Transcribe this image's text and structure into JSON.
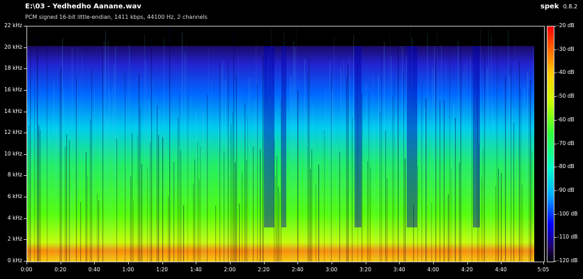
{
  "header": {
    "file_title": "E:\\03 - Yedhedho Aanane.wav",
    "format_info": "PCM signed 16-bit little-endian, 1411 kbps, 44100 Hz, 2 channels",
    "app_name": "spek",
    "app_version": "0.8.2"
  },
  "chart_data": {
    "type": "heatmap",
    "title": "E:\\03 - Yedhedho Aanane.wav",
    "subtitle": "PCM signed 16-bit little-endian, 1411 kbps, 44100 Hz, 2 channels",
    "y_ticks": [
      "22 kHz",
      "20 kHz",
      "18 kHz",
      "16 kHz",
      "14 kHz",
      "12 kHz",
      "10 kHz",
      "8 kHz",
      "6 kHz",
      "4 kHz",
      "2 kHz",
      "0 kHz"
    ],
    "x_ticks": [
      "0:00",
      "0:20",
      "0:40",
      "1:00",
      "1:20",
      "1:40",
      "2:00",
      "2:20",
      "2:40",
      "3:00",
      "3:20",
      "3:40",
      "4:00",
      "4:20",
      "4:40",
      "5:05"
    ],
    "db_ticks": [
      "-20 dB",
      "-30 dB",
      "-40 dB",
      "-50 dB",
      "-60 dB",
      "-70 dB",
      "-80 dB",
      "-90 dB",
      "-100 dB",
      "-110 dB",
      "-120 dB"
    ],
    "ylim_khz": [
      0,
      22
    ],
    "xlim_seconds": [
      0,
      305
    ],
    "db_range": [
      -120,
      -20
    ]
  }
}
